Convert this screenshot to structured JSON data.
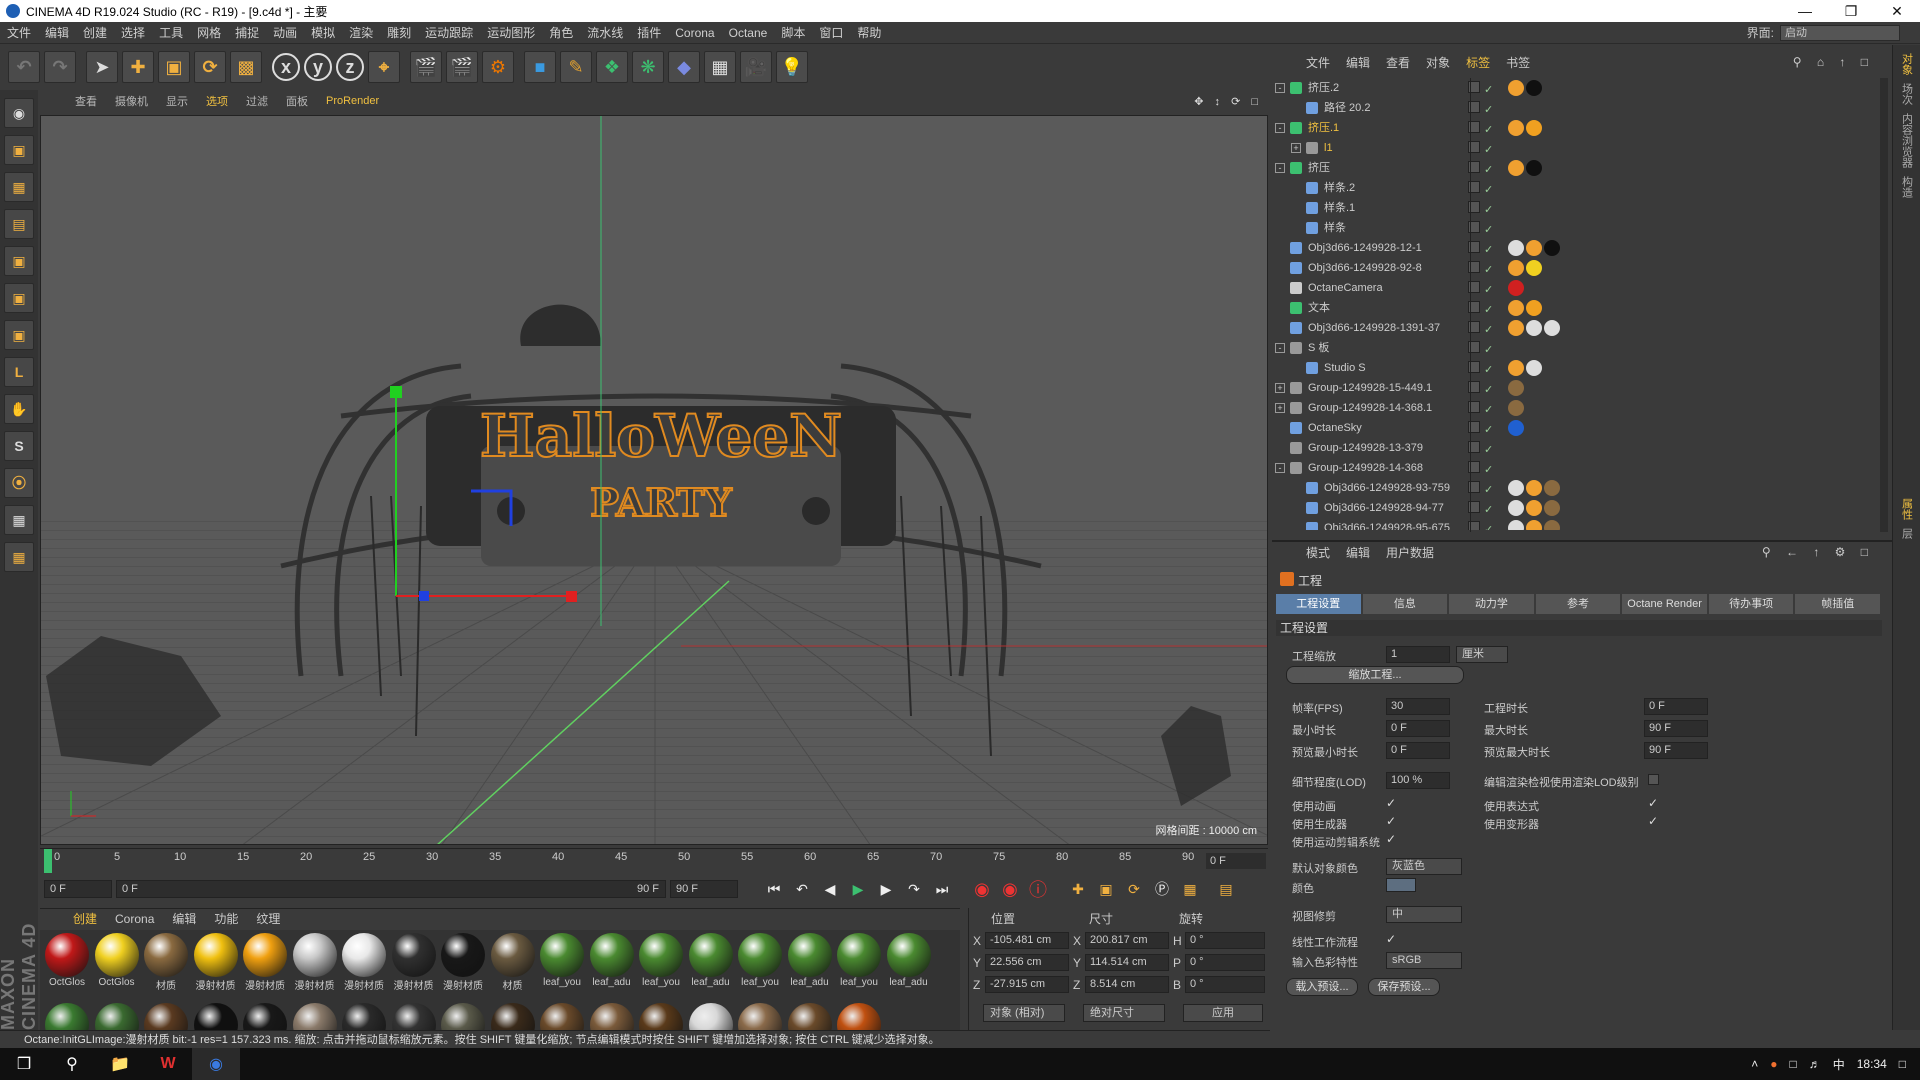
{
  "window": {
    "title": "CINEMA 4D R19.024 Studio (RC - R19) - [9.c4d *] - 主要"
  },
  "menu": {
    "items": [
      "文件",
      "编辑",
      "创建",
      "选择",
      "工具",
      "网格",
      "捕捉",
      "动画",
      "模拟",
      "渲染",
      "雕刻",
      "运动跟踪",
      "运动图形",
      "角色",
      "流水线",
      "插件",
      "Corona",
      "Octane",
      "脚本",
      "窗口",
      "帮助"
    ],
    "layout_label": "界面:",
    "layout_value": "启动"
  },
  "viewport": {
    "menu": [
      "查看",
      "摄像机",
      "显示",
      "选项",
      "过滤",
      "面板",
      "ProRender"
    ],
    "active_item": "选项",
    "grid_info": "网格间距 : 10000 cm",
    "sign_text_1": "HalloWeeN",
    "sign_text_2": "PARTY",
    "axis_x": "x",
    "axis_y": "y",
    "axis_z": "z"
  },
  "timeline": {
    "ticks": [
      "0",
      "5",
      "10",
      "15",
      "20",
      "25",
      "30",
      "35",
      "40",
      "45",
      "50",
      "55",
      "60",
      "65",
      "70",
      "75",
      "80",
      "85",
      "90"
    ],
    "current_frame": "0 F",
    "start": "0 F",
    "range_start": "0 F",
    "range_end": "90 F",
    "end": "90 F"
  },
  "material_manager": {
    "menu": [
      "创建",
      "Corona",
      "编辑",
      "功能",
      "纹理"
    ],
    "materials": [
      {
        "name": "OctGlos",
        "color": "#c01818"
      },
      {
        "name": "OctGlos",
        "color": "#f0d020"
      },
      {
        "name": "材质",
        "color": "#8a6a40"
      },
      {
        "name": "漫射材质",
        "color": "#f0c010"
      },
      {
        "name": "漫射材质",
        "color": "#f0a010"
      },
      {
        "name": "漫射材质",
        "color": "#c8c8c8"
      },
      {
        "name": "漫射材质",
        "color": "#e8e8e8"
      },
      {
        "name": "漫射材质",
        "color": "#303030"
      },
      {
        "name": "漫射材质",
        "color": "#181818"
      },
      {
        "name": "材质",
        "color": "#6a5a40"
      },
      {
        "name": "leaf_you",
        "color": "#4a8a30"
      },
      {
        "name": "leaf_adu",
        "color": "#4a8a30"
      },
      {
        "name": "leaf_you",
        "color": "#4a8a30"
      },
      {
        "name": "leaf_adu",
        "color": "#4a8a30"
      },
      {
        "name": "leaf_you",
        "color": "#4a8a30"
      },
      {
        "name": "leaf_adu",
        "color": "#4a8a30"
      },
      {
        "name": "leaf_you",
        "color": "#4a8a30"
      },
      {
        "name": "leaf_adu",
        "color": "#4a8a30"
      }
    ],
    "second_row_colors": [
      "#3a7a30",
      "#3a6a30",
      "#5a3a20",
      "#101010",
      "#181818",
      "#8a7a6a",
      "#2a2a2a",
      "#333",
      "#5a5a4a",
      "#3a2a1a",
      "#6a4a2a",
      "#7a5a3a",
      "#5a3a1a",
      "#d8d8d8",
      "#8a6a4a",
      "#6a4a2a",
      "#c05010"
    ]
  },
  "coords": {
    "headers": [
      "位置",
      "尺寸",
      "旋转"
    ],
    "rows": [
      {
        "axis": "X",
        "pos": "-105.481 cm",
        "size_axis": "X",
        "size": "200.817 cm",
        "rot_axis": "H",
        "rot": "0 °"
      },
      {
        "axis": "Y",
        "pos": "22.556 cm",
        "size_axis": "Y",
        "size": "114.514 cm",
        "rot_axis": "P",
        "rot": "0 °"
      },
      {
        "axis": "Z",
        "pos": "-27.915 cm",
        "size_axis": "Z",
        "size": "8.514 cm",
        "rot_axis": "B",
        "rot": "0 °"
      }
    ],
    "mode": "对象 (相对)",
    "size_mode": "绝对尺寸",
    "apply": "应用"
  },
  "status": "Octane:InitGLImage:漫射材质 bit:-1 res=1 157.323 ms.   缩放: 点击并拖动鼠标缩放元素。按住 SHIFT 键量化缩放; 节点编辑模式时按住 SHIFT 键增加选择对象; 按住 CTRL 键减少选择对象。",
  "object_manager": {
    "menu": [
      "文件",
      "编辑",
      "查看",
      "对象",
      "标签",
      "书签"
    ],
    "active_menu": "标签",
    "objects": [
      {
        "name": "挤压.2",
        "indent": 0,
        "expand": "-",
        "icon": "#3cc070",
        "tags": [
          "#f0a030",
          "#101010"
        ]
      },
      {
        "name": "路径 20.2",
        "indent": 1,
        "expand": "",
        "icon": "#70a0e0",
        "tags": []
      },
      {
        "name": "挤压.1",
        "indent": 0,
        "expand": "-",
        "icon": "#3cc070",
        "tags": [
          "#f0a030",
          "#f0a020"
        ],
        "hl": true
      },
      {
        "name": "l1",
        "indent": 1,
        "expand": "+",
        "icon": "#999",
        "tags": [],
        "hl": true
      },
      {
        "name": "挤压",
        "indent": 0,
        "expand": "-",
        "icon": "#3cc070",
        "tags": [
          "#f0a030",
          "#101010"
        ]
      },
      {
        "name": "样条.2",
        "indent": 1,
        "expand": "",
        "icon": "#70a0e0",
        "tags": []
      },
      {
        "name": "样条.1",
        "indent": 1,
        "expand": "",
        "icon": "#70a0e0",
        "tags": []
      },
      {
        "name": "样条",
        "indent": 1,
        "expand": "",
        "icon": "#70a0e0",
        "tags": []
      },
      {
        "name": "Obj3d66-1249928-12-1",
        "indent": 0,
        "expand": "",
        "icon": "#70a0e0",
        "tags": [
          "#ddd",
          "#f0a030",
          "#101010"
        ]
      },
      {
        "name": "Obj3d66-1249928-92-8",
        "indent": 0,
        "expand": "",
        "icon": "#70a0e0",
        "tags": [
          "#f0a030",
          "#f0d020"
        ]
      },
      {
        "name": "OctaneCamera",
        "indent": 0,
        "expand": "",
        "icon": "#ccc",
        "tags": [
          "#d02020"
        ]
      },
      {
        "name": "文本",
        "indent": 0,
        "expand": "",
        "icon": "#3cc070",
        "tags": [
          "#f0a030",
          "#f0a020"
        ]
      },
      {
        "name": "Obj3d66-1249928-1391-37",
        "indent": 0,
        "expand": "",
        "icon": "#70a0e0",
        "tags": [
          "#f0a030",
          "#ddd",
          "#ddd"
        ]
      },
      {
        "name": "S 板",
        "indent": 0,
        "expand": "-",
        "icon": "#999",
        "tags": []
      },
      {
        "name": "Studio S",
        "indent": 1,
        "expand": "",
        "icon": "#70a0e0",
        "tags": [
          "#f0a030",
          "#ddd"
        ]
      },
      {
        "name": "Group-1249928-15-449.1",
        "indent": 0,
        "expand": "+",
        "icon": "#999",
        "tags": [
          "#8a6a40"
        ]
      },
      {
        "name": "Group-1249928-14-368.1",
        "indent": 0,
        "expand": "+",
        "icon": "#999",
        "tags": [
          "#8a6a40"
        ]
      },
      {
        "name": "OctaneSky",
        "indent": 0,
        "expand": "",
        "icon": "#70a0e0",
        "tags": [
          "#2060d0"
        ]
      },
      {
        "name": "Group-1249928-13-379",
        "indent": 0,
        "expand": "",
        "icon": "#999",
        "tags": []
      },
      {
        "name": "Group-1249928-14-368",
        "indent": 0,
        "expand": "-",
        "icon": "#999",
        "tags": []
      },
      {
        "name": "Obj3d66-1249928-93-759",
        "indent": 1,
        "expand": "",
        "icon": "#70a0e0",
        "tags": [
          "#ddd",
          "#f0a030",
          "#8a6a40"
        ]
      },
      {
        "name": "Obj3d66-1249928-94-77",
        "indent": 1,
        "expand": "",
        "icon": "#70a0e0",
        "tags": [
          "#ddd",
          "#f0a030",
          "#8a6a40"
        ]
      },
      {
        "name": "Obj3d66-1249928-95-675",
        "indent": 1,
        "expand": "",
        "icon": "#70a0e0",
        "tags": [
          "#ddd",
          "#f0a030",
          "#8a6a40"
        ]
      }
    ]
  },
  "attribute_manager": {
    "menu": [
      "模式",
      "编辑",
      "用户数据"
    ],
    "panel_title": "工程",
    "tabs": [
      "工程设置",
      "信息",
      "动力学",
      "参考",
      "Octane Render",
      "待办事项",
      "帧插值"
    ],
    "active_tab": "工程设置",
    "section": "工程设置",
    "project_scale_label": "工程缩放",
    "project_scale_value": "1",
    "project_scale_unit": "厘米",
    "scale_button": "缩放工程...",
    "fps_label": "帧率(FPS)",
    "fps_value": "30",
    "duration_label": "工程时长",
    "duration_value": "0 F",
    "min_time_label": "最小时长",
    "min_time_value": "0 F",
    "max_time_label": "最大时长",
    "max_time_value": "90 F",
    "preview_min_label": "预览最小时长",
    "preview_min_value": "0 F",
    "preview_max_label": "预览最大时长",
    "preview_max_value": "90 F",
    "lod_label": "细节程度(LOD)",
    "lod_value": "100 %",
    "render_lod_label": "编辑渲染检视使用渲染LOD级别",
    "use_anim_label": "使用动画",
    "use_expr_label": "使用表达式",
    "use_gen_label": "使用生成器",
    "use_deform_label": "使用变形器",
    "use_mograph_label": "使用运动剪辑系统",
    "default_color_label": "默认对象颜色",
    "default_color_value": "灰蓝色",
    "color_label": "颜色",
    "view_clip_label": "视图修剪",
    "view_clip_value": "中",
    "linear_label": "线性工作流程",
    "input_color_label": "输入色彩特性",
    "input_color_value": "sRGB",
    "load_preset": "载入预设...",
    "save_preset": "保存预设..."
  },
  "right_strip": [
    "对象",
    "场次",
    "内容浏览器",
    "构造",
    "属性",
    "层"
  ],
  "taskbar": {
    "time": "18:34"
  },
  "logo": "MAXON CINEMA 4D"
}
